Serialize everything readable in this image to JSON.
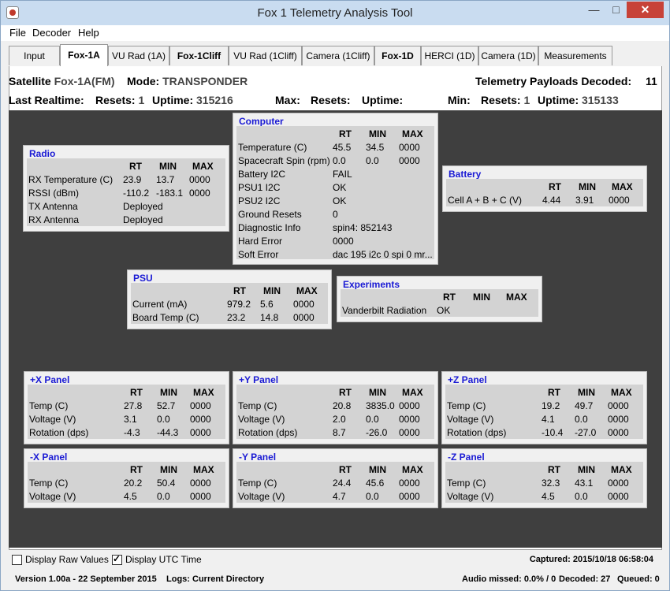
{
  "window": {
    "title": "Fox 1 Telemetry Analysis Tool",
    "min": "—",
    "max": "□",
    "close": "✕"
  },
  "menu": [
    "File",
    "Decoder",
    "Help"
  ],
  "tabs": [
    "Input",
    "Fox-1A",
    "VU Rad (1A)",
    "Fox-1Cliff",
    "VU Rad (1Cliff)",
    "Camera (1Cliff)",
    "Fox-1D",
    "HERCI (1D)",
    "Camera (1D)",
    "Measurements"
  ],
  "header": {
    "satellite_label": "Satellite",
    "satellite_value": "Fox-1A(FM)",
    "mode_label": "Mode:",
    "mode_value": "TRANSPONDER",
    "payloads_label": "Telemetry Payloads Decoded:",
    "payloads_value": "11",
    "last_rt_label": "Last Realtime:",
    "resets_label": "Resets:",
    "resets_value": "1",
    "uptime_label": "Uptime:",
    "uptime_value": "315216",
    "max_label": "Max:",
    "max_resets_label": "Resets:",
    "max_uptime_label": "Uptime:",
    "min_label": "Min:",
    "min_resets_label": "Resets:",
    "min_resets_value": "1",
    "min_uptime_label": "Uptime:",
    "min_uptime_value": "315133"
  },
  "cols": {
    "rt": "RT",
    "min": "MIN",
    "max": "MAX"
  },
  "panels": {
    "radio": {
      "title": "Radio",
      "rows": [
        [
          "RX Temperature (C)",
          "23.9",
          "13.7",
          "0000"
        ],
        [
          "RSSI (dBm)",
          "-110.2",
          "-183.1",
          "0000"
        ],
        [
          "TX Antenna",
          "Deployed",
          "",
          ""
        ],
        [
          "RX Antenna",
          "Deployed",
          "",
          ""
        ]
      ]
    },
    "computer": {
      "title": "Computer",
      "rows": [
        [
          "Temperature (C)",
          "45.5",
          "34.5",
          "0000"
        ],
        [
          "Spacecraft Spin (rpm)",
          "0.0",
          "0.0",
          "0000"
        ],
        [
          "Battery I2C",
          "FAIL",
          "",
          ""
        ],
        [
          "PSU1 I2C",
          "OK",
          "",
          ""
        ],
        [
          "PSU2 I2C",
          "OK",
          "",
          ""
        ],
        [
          "Ground Resets",
          "0",
          "",
          ""
        ],
        [
          "Diagnostic Info",
          "spin4: 852143",
          "",
          ""
        ],
        [
          "Hard Error",
          "0000",
          "",
          ""
        ],
        [
          "Soft Error",
          "dac 195 i2c 0 spi 0 mr...",
          "",
          ""
        ]
      ]
    },
    "battery": {
      "title": "Battery",
      "rows": [
        [
          "Cell A + B + C (V)",
          "4.44",
          "3.91",
          "0000"
        ]
      ]
    },
    "psu": {
      "title": "PSU",
      "rows": [
        [
          "Current (mA)",
          "979.2",
          "5.6",
          "0000"
        ],
        [
          "Board Temp (C)",
          "23.2",
          "14.8",
          "0000"
        ]
      ]
    },
    "experiments": {
      "title": "Experiments",
      "rows": [
        [
          "Vanderbilt Radiation",
          "OK",
          "",
          ""
        ]
      ]
    },
    "xplus": {
      "title": "+X Panel",
      "rows": [
        [
          "Temp (C)",
          "27.8",
          "52.7",
          "0000"
        ],
        [
          "Voltage (V)",
          "3.1",
          "0.0",
          "0000"
        ],
        [
          "Rotation (dps)",
          "-4.3",
          "-44.3",
          "0000"
        ]
      ]
    },
    "yplus": {
      "title": "+Y Panel",
      "rows": [
        [
          "Temp (C)",
          "20.8",
          "3835.0",
          "0000"
        ],
        [
          "Voltage (V)",
          "2.0",
          "0.0",
          "0000"
        ],
        [
          "Rotation (dps)",
          "8.7",
          "-26.0",
          "0000"
        ]
      ]
    },
    "zplus": {
      "title": "+Z Panel",
      "rows": [
        [
          "Temp (C)",
          "19.2",
          "49.7",
          "0000"
        ],
        [
          "Voltage (V)",
          "4.1",
          "0.0",
          "0000"
        ],
        [
          "Rotation (dps)",
          "-10.4",
          "-27.0",
          "0000"
        ]
      ]
    },
    "xminus": {
      "title": "-X Panel",
      "rows": [
        [
          "Temp (C)",
          "20.2",
          "50.4",
          "0000"
        ],
        [
          "Voltage (V)",
          "4.5",
          "0.0",
          "0000"
        ]
      ]
    },
    "yminus": {
      "title": "-Y Panel",
      "rows": [
        [
          "Temp (C)",
          "24.4",
          "45.6",
          "0000"
        ],
        [
          "Voltage (V)",
          "4.7",
          "0.0",
          "0000"
        ]
      ]
    },
    "zminus": {
      "title": "-Z Panel",
      "rows": [
        [
          "Temp (C)",
          "32.3",
          "43.1",
          "0000"
        ],
        [
          "Voltage (V)",
          "4.5",
          "0.0",
          "0000"
        ]
      ]
    }
  },
  "bottom": {
    "raw_label": "Display Raw Values",
    "raw_checked": false,
    "utc_label": "Display UTC Time",
    "utc_checked": true,
    "captured": "Captured: 2015/10/18 06:58:04"
  },
  "status": {
    "version": "Version 1.00a - 22 September 2015",
    "logs": "Logs: Current Directory",
    "audio": "Audio missed: 0.0% / 0",
    "decoded": "Decoded: 27",
    "queued": "Queued: 0"
  }
}
